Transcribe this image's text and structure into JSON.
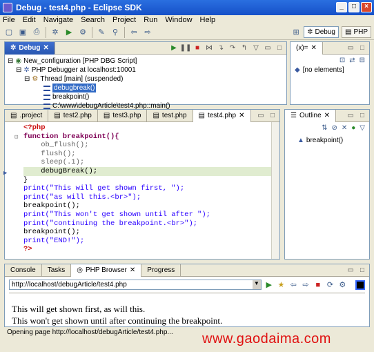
{
  "window": {
    "title": "Debug - test4.php - Eclipse SDK"
  },
  "menu": [
    "File",
    "Edit",
    "Navigate",
    "Search",
    "Project",
    "Run",
    "Window",
    "Help"
  ],
  "perspectives": [
    {
      "label": "Debug",
      "active": true
    },
    {
      "label": "PHP",
      "active": false
    }
  ],
  "debug_view": {
    "tab": "Debug",
    "tree": [
      {
        "label": "New_configuration [PHP DBG Script]",
        "indent": 0,
        "selected": false
      },
      {
        "label": "PHP Debugger at localhost:10001",
        "indent": 1,
        "selected": false
      },
      {
        "label": "Thread [main] (suspended)",
        "indent": 2,
        "selected": false
      },
      {
        "label": "debugbreak()",
        "indent": 3,
        "selected": true
      },
      {
        "label": "breakpoint()",
        "indent": 3,
        "selected": false
      },
      {
        "label": "C:\\www\\debugArticle\\test4.php::main()",
        "indent": 3,
        "selected": false
      }
    ]
  },
  "variables_view": {
    "tab_icon": "(x)=",
    "empty_text": "[no elements]"
  },
  "editor": {
    "tabs": [
      ".project",
      "test2.php",
      "test3.php",
      "test.php",
      "test4.php"
    ],
    "active_tab": "test4.php",
    "lines": [
      "<?php",
      "function breakpoint(){",
      "    ob_flush();",
      "    flush();",
      "    sleep(.1);",
      "    debugBreak();",
      "}",
      "print(\"This will get shown first, \");",
      "print(\"as will this.<br>\");",
      "breakpoint();",
      "print(\"This won't get shown until after \");",
      "print(\"continuing the breakpoint.<br>\");",
      "breakpoint();",
      "print(\"END!\");",
      "?>"
    ],
    "highlight_line": 6
  },
  "outline_view": {
    "tab": "Outline",
    "items": [
      "breakpoint()"
    ]
  },
  "bottom_panel": {
    "tabs": [
      "Console",
      "Tasks",
      "PHP Browser",
      "Progress"
    ],
    "active_tab": "PHP Browser",
    "url": "http://localhost/debugArticle/test4.php",
    "page_lines": [
      "This will get shown first, as will this.",
      "This won't get shown until after continuing the breakpoint."
    ]
  },
  "status": {
    "text": "Opening page http://localhost/debugArticle/test4.php..."
  },
  "watermark": "www.gaodaima.com",
  "colors": {
    "title_blue": "#1550c8",
    "selection": "#316ac5",
    "watermark": "#e01010"
  }
}
